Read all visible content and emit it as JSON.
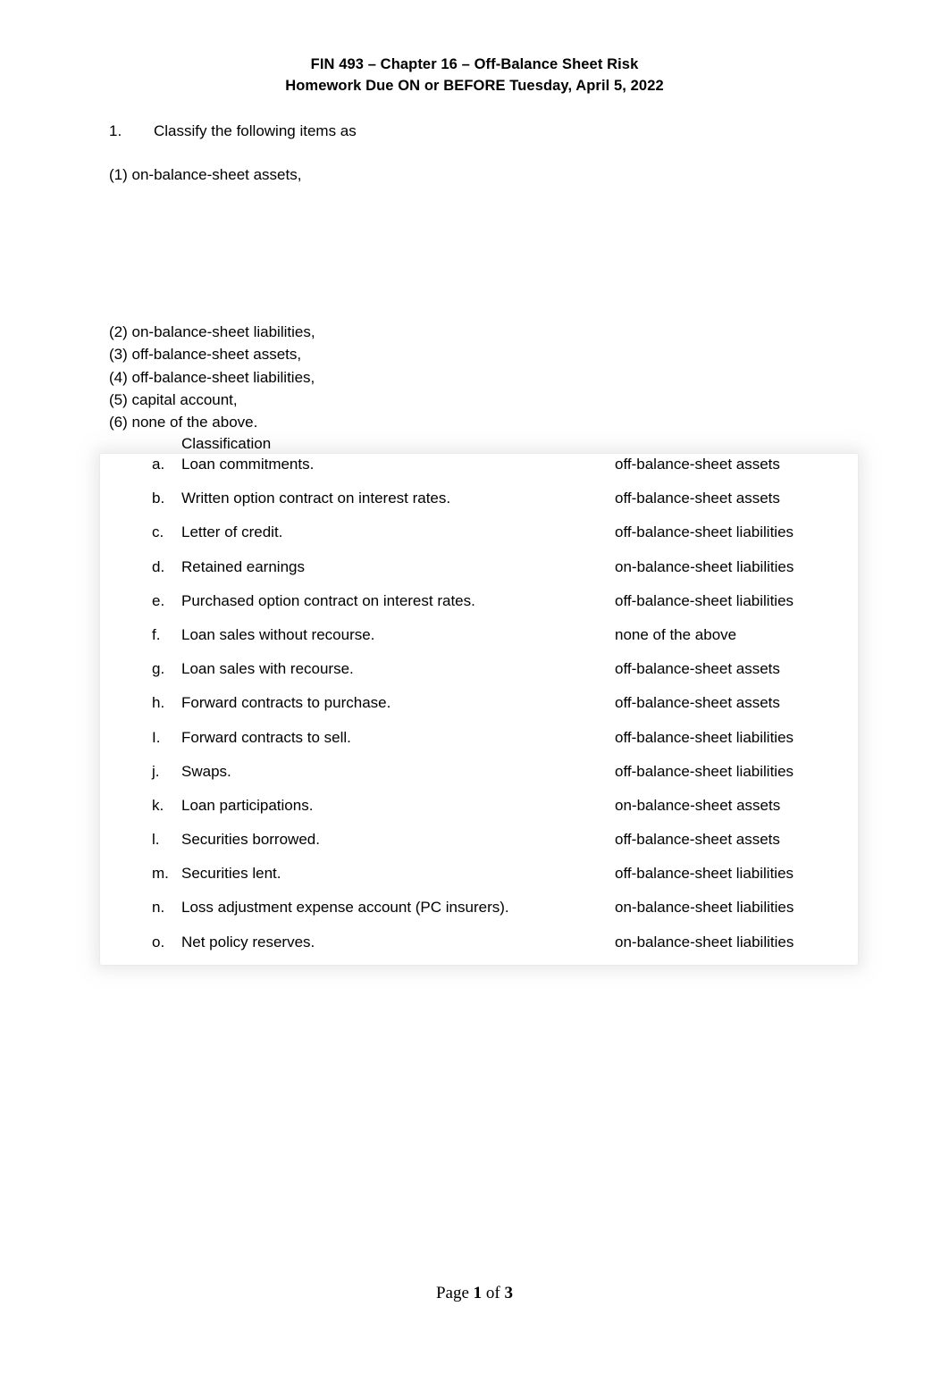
{
  "header": {
    "line1": "FIN 493 – Chapter 16 – Off-Balance Sheet Risk",
    "line2": "Homework Due ON or BEFORE Tuesday, April 5, 2022"
  },
  "question": {
    "number": "1.",
    "prompt": "Classify the following items as",
    "options": [
      "(1) on-balance-sheet assets,",
      "(2) on-balance-sheet liabilities,",
      "(3) off-balance-sheet assets,",
      "(4) off-balance-sheet liabilities,",
      "(5) capital account,",
      "(6) none of the above."
    ],
    "column_header": "Classification"
  },
  "table": {
    "rows": [
      {
        "letter": "a.",
        "item": "Loan commitments.",
        "classification": "off-balance-sheet assets"
      },
      {
        "letter": "b.",
        "item": "Written option contract on interest rates.",
        "classification": "off-balance-sheet assets"
      },
      {
        "letter": "c.",
        "item": "Letter of credit.",
        "classification": "off-balance-sheet liabilities"
      },
      {
        "letter": "d.",
        "item": "Retained earnings",
        "classification": "on-balance-sheet liabilities"
      },
      {
        "letter": "e.",
        "item": "Purchased option contract on interest rates.",
        "classification": "off-balance-sheet liabilities"
      },
      {
        "letter": "f.",
        "item": "Loan sales without recourse.",
        "classification": "none of the above"
      },
      {
        "letter": "g.",
        "item": "Loan sales with recourse.",
        "classification": "off-balance-sheet assets"
      },
      {
        "letter": "h.",
        "item": "Forward contracts to purchase.",
        "classification": "off-balance-sheet assets"
      },
      {
        "letter": "I.",
        "item": "Forward contracts to sell.",
        "classification": "off-balance-sheet liabilities"
      },
      {
        "letter": "j.",
        "item": "Swaps.",
        "classification": "off-balance-sheet liabilities"
      },
      {
        "letter": "k.",
        "item": "Loan participations.",
        "classification": "on-balance-sheet assets"
      },
      {
        "letter": "l.",
        "item": "Securities borrowed.",
        "classification": "off-balance-sheet assets"
      },
      {
        "letter": "m.",
        "item": "Securities lent.",
        "classification": "off-balance-sheet liabilities"
      },
      {
        "letter": "n.",
        "item": "Loss adjustment expense account (PC insurers).",
        "classification": "on-balance-sheet liabilities"
      },
      {
        "letter": "o.",
        "item": "Net policy reserves.",
        "classification": "on-balance-sheet liabilities"
      }
    ]
  },
  "footer": {
    "prefix": "Page ",
    "page_number": "1",
    "middle": " of ",
    "page_total": "3"
  }
}
